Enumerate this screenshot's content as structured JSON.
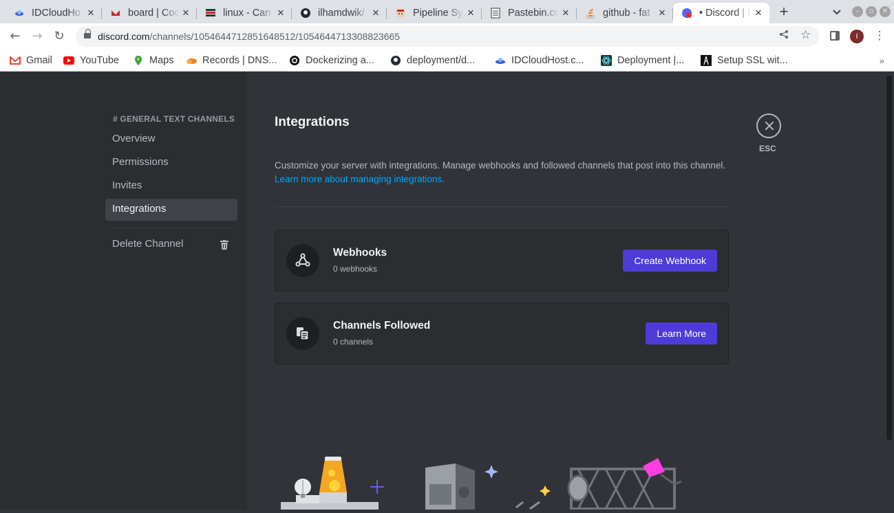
{
  "browser": {
    "tabs": [
      {
        "title": "IDCloudHo",
        "icon": "idcloudhost-icon"
      },
      {
        "title": "board | Coc",
        "icon": "board-icon"
      },
      {
        "title": "linux - Can",
        "icon": "stackexchange-icon"
      },
      {
        "title": "ilhamdwik/",
        "icon": "github-icon"
      },
      {
        "title": "Pipeline Sy",
        "icon": "jenkins-icon"
      },
      {
        "title": "Pastebin.co",
        "icon": "pastebin-icon"
      },
      {
        "title": "github - fat",
        "icon": "stackoverflow-icon"
      },
      {
        "title": "• Discord | I",
        "icon": "discord-icon",
        "active": true
      }
    ],
    "url_host": "discord.com",
    "url_path": "/channels/1054644712851648512/1054644713308823665",
    "profile_initial": "I",
    "bookmarks": [
      {
        "label": "Gmail",
        "icon": "gmail-icon"
      },
      {
        "label": "YouTube",
        "icon": "youtube-icon"
      },
      {
        "label": "Maps",
        "icon": "maps-icon"
      },
      {
        "label": "Records | DNS...",
        "icon": "cloudflare-icon"
      },
      {
        "label": "Dockerizing a...",
        "icon": "medium-icon"
      },
      {
        "label": "deployment/d...",
        "icon": "github-icon"
      },
      {
        "label": "IDCloudHost.c...",
        "icon": "idcloudhost-icon"
      },
      {
        "label": "Deployment |...",
        "icon": "react-icon"
      },
      {
        "label": "Setup SSL wit...",
        "icon": "tower-icon"
      }
    ]
  },
  "sidebar": {
    "header": "GENERAL TEXT CHANNELS",
    "items": [
      {
        "label": "Overview"
      },
      {
        "label": "Permissions"
      },
      {
        "label": "Invites"
      },
      {
        "label": "Integrations",
        "selected": true
      }
    ],
    "delete_label": "Delete Channel"
  },
  "main": {
    "title": "Integrations",
    "description": "Customize your server with integrations. Manage webhooks and followed channels that post into this channel.",
    "learn_link": "Learn more about managing integrations.",
    "esc_label": "ESC",
    "cards": [
      {
        "title": "Webhooks",
        "subtitle": "0 webhooks",
        "button": "Create Webhook",
        "icon": "webhook-icon"
      },
      {
        "title": "Channels Followed",
        "subtitle": "0 channels",
        "button": "Learn More",
        "icon": "channel-follow-icon"
      }
    ]
  },
  "colors": {
    "accent_button": "#4e3bd8",
    "link": "#00a8fc",
    "sidebar_bg": "#2b2d31",
    "content_bg": "#313338"
  }
}
